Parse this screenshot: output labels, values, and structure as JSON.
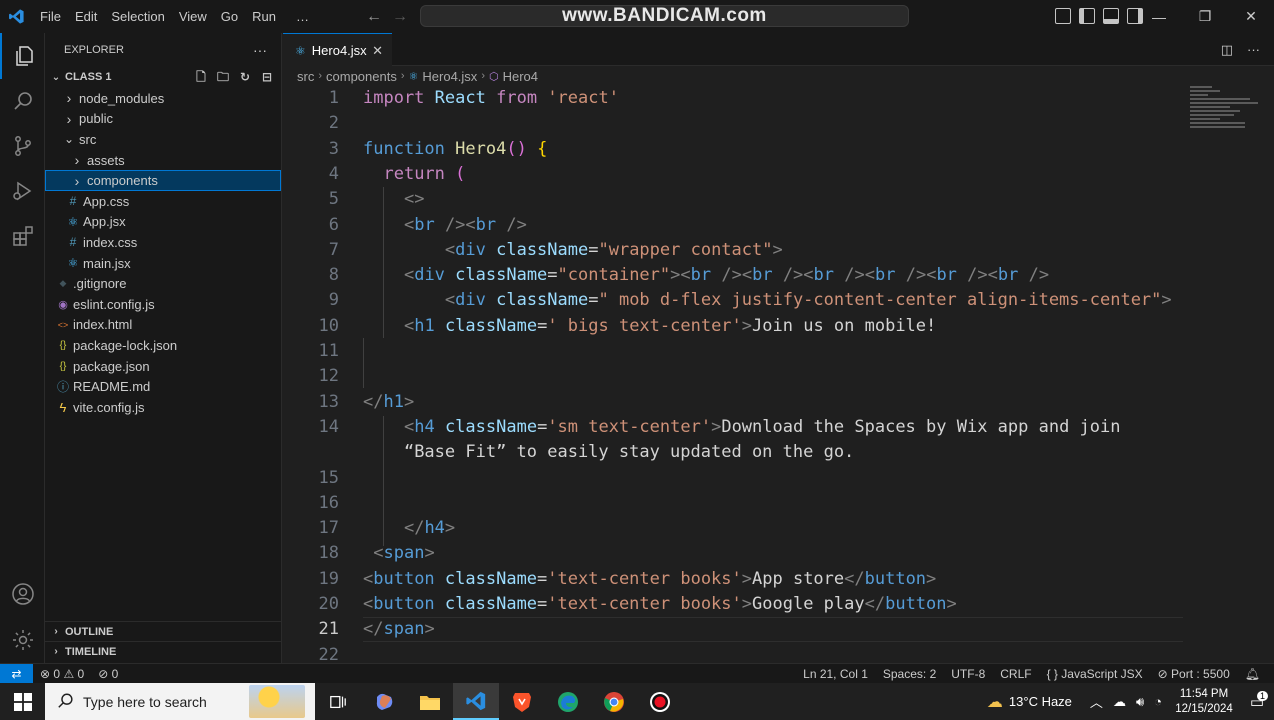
{
  "title_bar": {
    "menu": [
      "File",
      "Edit",
      "Selection",
      "View",
      "Go",
      "Run",
      "…"
    ],
    "command_center_text": "www.BANDICAM.com"
  },
  "sidebar": {
    "header": "EXPLORER",
    "more": "···",
    "folder": "CLASS 1",
    "items": [
      {
        "label": "node_modules",
        "icon": "chevron-right-icon",
        "depth": 1
      },
      {
        "label": "public",
        "icon": "chevron-right-icon",
        "depth": 1
      },
      {
        "label": "src",
        "icon": "chevron-down-icon",
        "depth": 1
      },
      {
        "label": "assets",
        "icon": "chevron-right-icon",
        "depth": 2
      },
      {
        "label": "components",
        "icon": "chevron-right-icon",
        "depth": 2,
        "selected": true
      },
      {
        "label": "App.css",
        "icon": "css-hash-icon",
        "depth": 2
      },
      {
        "label": "App.jsx",
        "icon": "react-icon",
        "depth": 2
      },
      {
        "label": "index.css",
        "icon": "css-hash-icon",
        "depth": 2
      },
      {
        "label": "main.jsx",
        "icon": "react-icon",
        "depth": 2
      },
      {
        "label": ".gitignore",
        "icon": "git-diamond-icon",
        "depth": 1
      },
      {
        "label": "eslint.config.js",
        "icon": "eslint-icon",
        "depth": 1
      },
      {
        "label": "index.html",
        "icon": "html-icon",
        "depth": 1
      },
      {
        "label": "package-lock.json",
        "icon": "json-braces-icon",
        "depth": 1
      },
      {
        "label": "package.json",
        "icon": "json-braces-icon",
        "depth": 1
      },
      {
        "label": "README.md",
        "icon": "info-icon",
        "depth": 1
      },
      {
        "label": "vite.config.js",
        "icon": "vite-icon",
        "depth": 1
      }
    ],
    "outline": "OUTLINE",
    "timeline": "TIMELINE"
  },
  "editor": {
    "tab": "Hero4.jsx",
    "breadcrumb": [
      "src",
      "components",
      "Hero4.jsx",
      "Hero4"
    ],
    "current_line": 21
  },
  "status_bar": {
    "errors": "0",
    "warnings": "0",
    "ports_count": "0",
    "position": "Ln 21, Col 1",
    "spaces": "Spaces: 2",
    "encoding": "UTF-8",
    "eol": "CRLF",
    "language": "JavaScript JSX",
    "port": "Port : 5500"
  },
  "taskbar": {
    "search_placeholder": "Type here to search",
    "weather": "13°C  Haze",
    "time": "11:54 PM",
    "date": "12/15/2024",
    "notification_count": "1"
  },
  "colors": {
    "accent": "#0078d4",
    "background": "#1f1f1f",
    "sidebar": "#181818"
  }
}
